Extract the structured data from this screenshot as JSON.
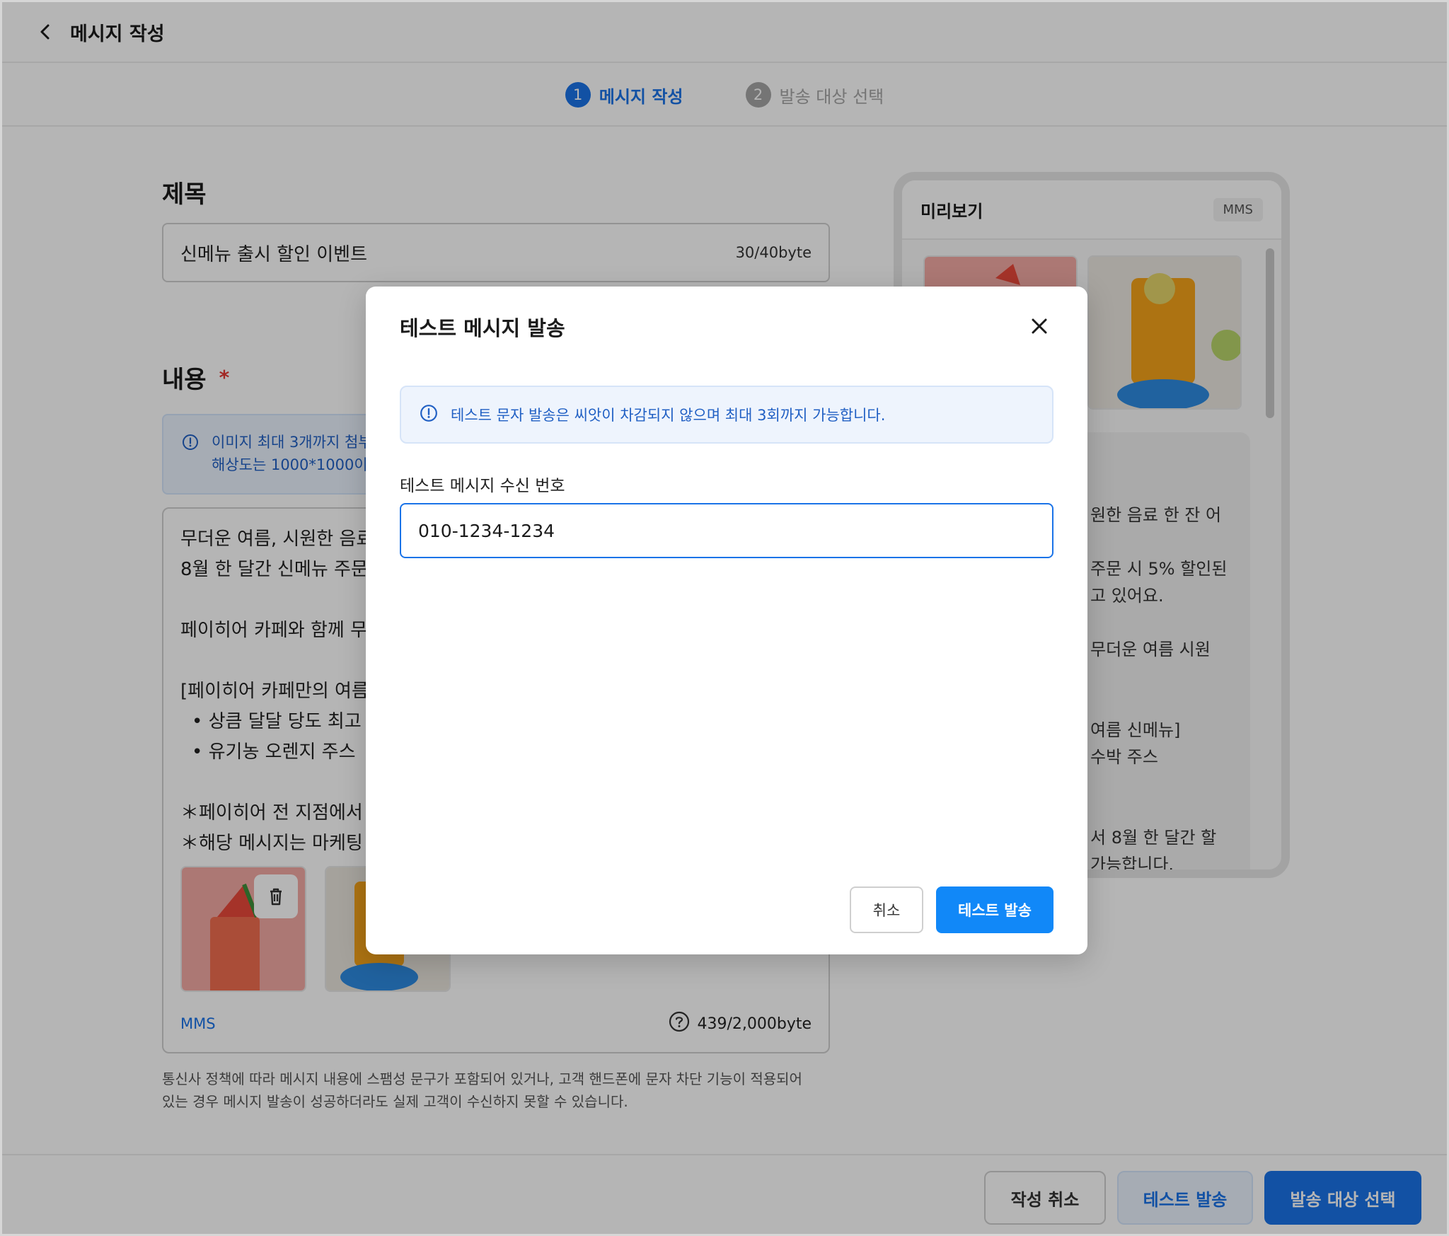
{
  "header": {
    "title": "메시지 작성",
    "back_icon": "chevron-left-icon"
  },
  "steps": [
    {
      "num": "1",
      "label": "메시지 작성",
      "state": "active"
    },
    {
      "num": "2",
      "label": "발송 대상 선택",
      "state": "inactive"
    }
  ],
  "title_section": {
    "heading": "제목",
    "value": "신메뉴 출시 할인 이벤트",
    "byte_count": "30/40byte"
  },
  "content_section": {
    "heading": "내용",
    "required_mark": "*",
    "info_line1": "이미지 최대 3개까지 첨부",
    "info_line2": "해상도는 1000*1000이",
    "lines": {
      "l1": "무더운 여름, 시원한 음료",
      "l2": "8월 한 달간 신메뉴 주문",
      "l3": "페이히어 카페와 함께 무",
      "l4": "[페이히어 카페만의 여름",
      "l5": "•  상큼 달달 당도 최고",
      "l6": "•  유기농 오렌지 주스",
      "l7": "＊페이히어 전 지점에서",
      "l8": "＊해당 메시지는 마케팅"
    },
    "type_tag": "MMS",
    "byte_count": "439/2,000byte",
    "help_icon": "question-circle-icon",
    "trash_icon": "trash-icon"
  },
  "note": {
    "line1": "통신사 정책에 따라 메시지 내용에 스팸성 문구가 포함되어 있거나, 고객 핸드폰에 문자 차단 기능이 적용되어",
    "line2": "있는 경우 메시지 발송이 성공하더라도 실제 고객이 수신하지 못할 수 있습니다."
  },
  "preview": {
    "title": "미리보기",
    "badge": "MMS",
    "lines": {
      "p1": "원한 음료 한 잔 어",
      "p2": "주문 시 5% 할인된",
      "p3": "고 있어요.",
      "p4": "무더운 여름 시원",
      "p5": "여름 신메뉴]",
      "p6": "수박 주스",
      "p7": "서 8월 한 달간 할",
      "p8": "가능합니다."
    }
  },
  "bottom_bar": {
    "cancel_label": "작성 취소",
    "test_label": "테스트 발송",
    "next_label": "발송 대상 선택"
  },
  "modal": {
    "title": "테스트 메시지 발송",
    "close_icon": "close-icon",
    "info_text": "테스트 문자 발송은 씨앗이 차감되지 않으며 최대 3회까지 가능합니다.",
    "field_label": "테스트 메시지 수신 번호",
    "phone_value": "010-1234-1234",
    "cancel_label": "취소",
    "send_label": "테스트 발송"
  },
  "colors": {
    "primary": "#1a73e8",
    "send_button": "#1188f8",
    "required": "#e53935",
    "info_bg": "#eaf3fe"
  }
}
